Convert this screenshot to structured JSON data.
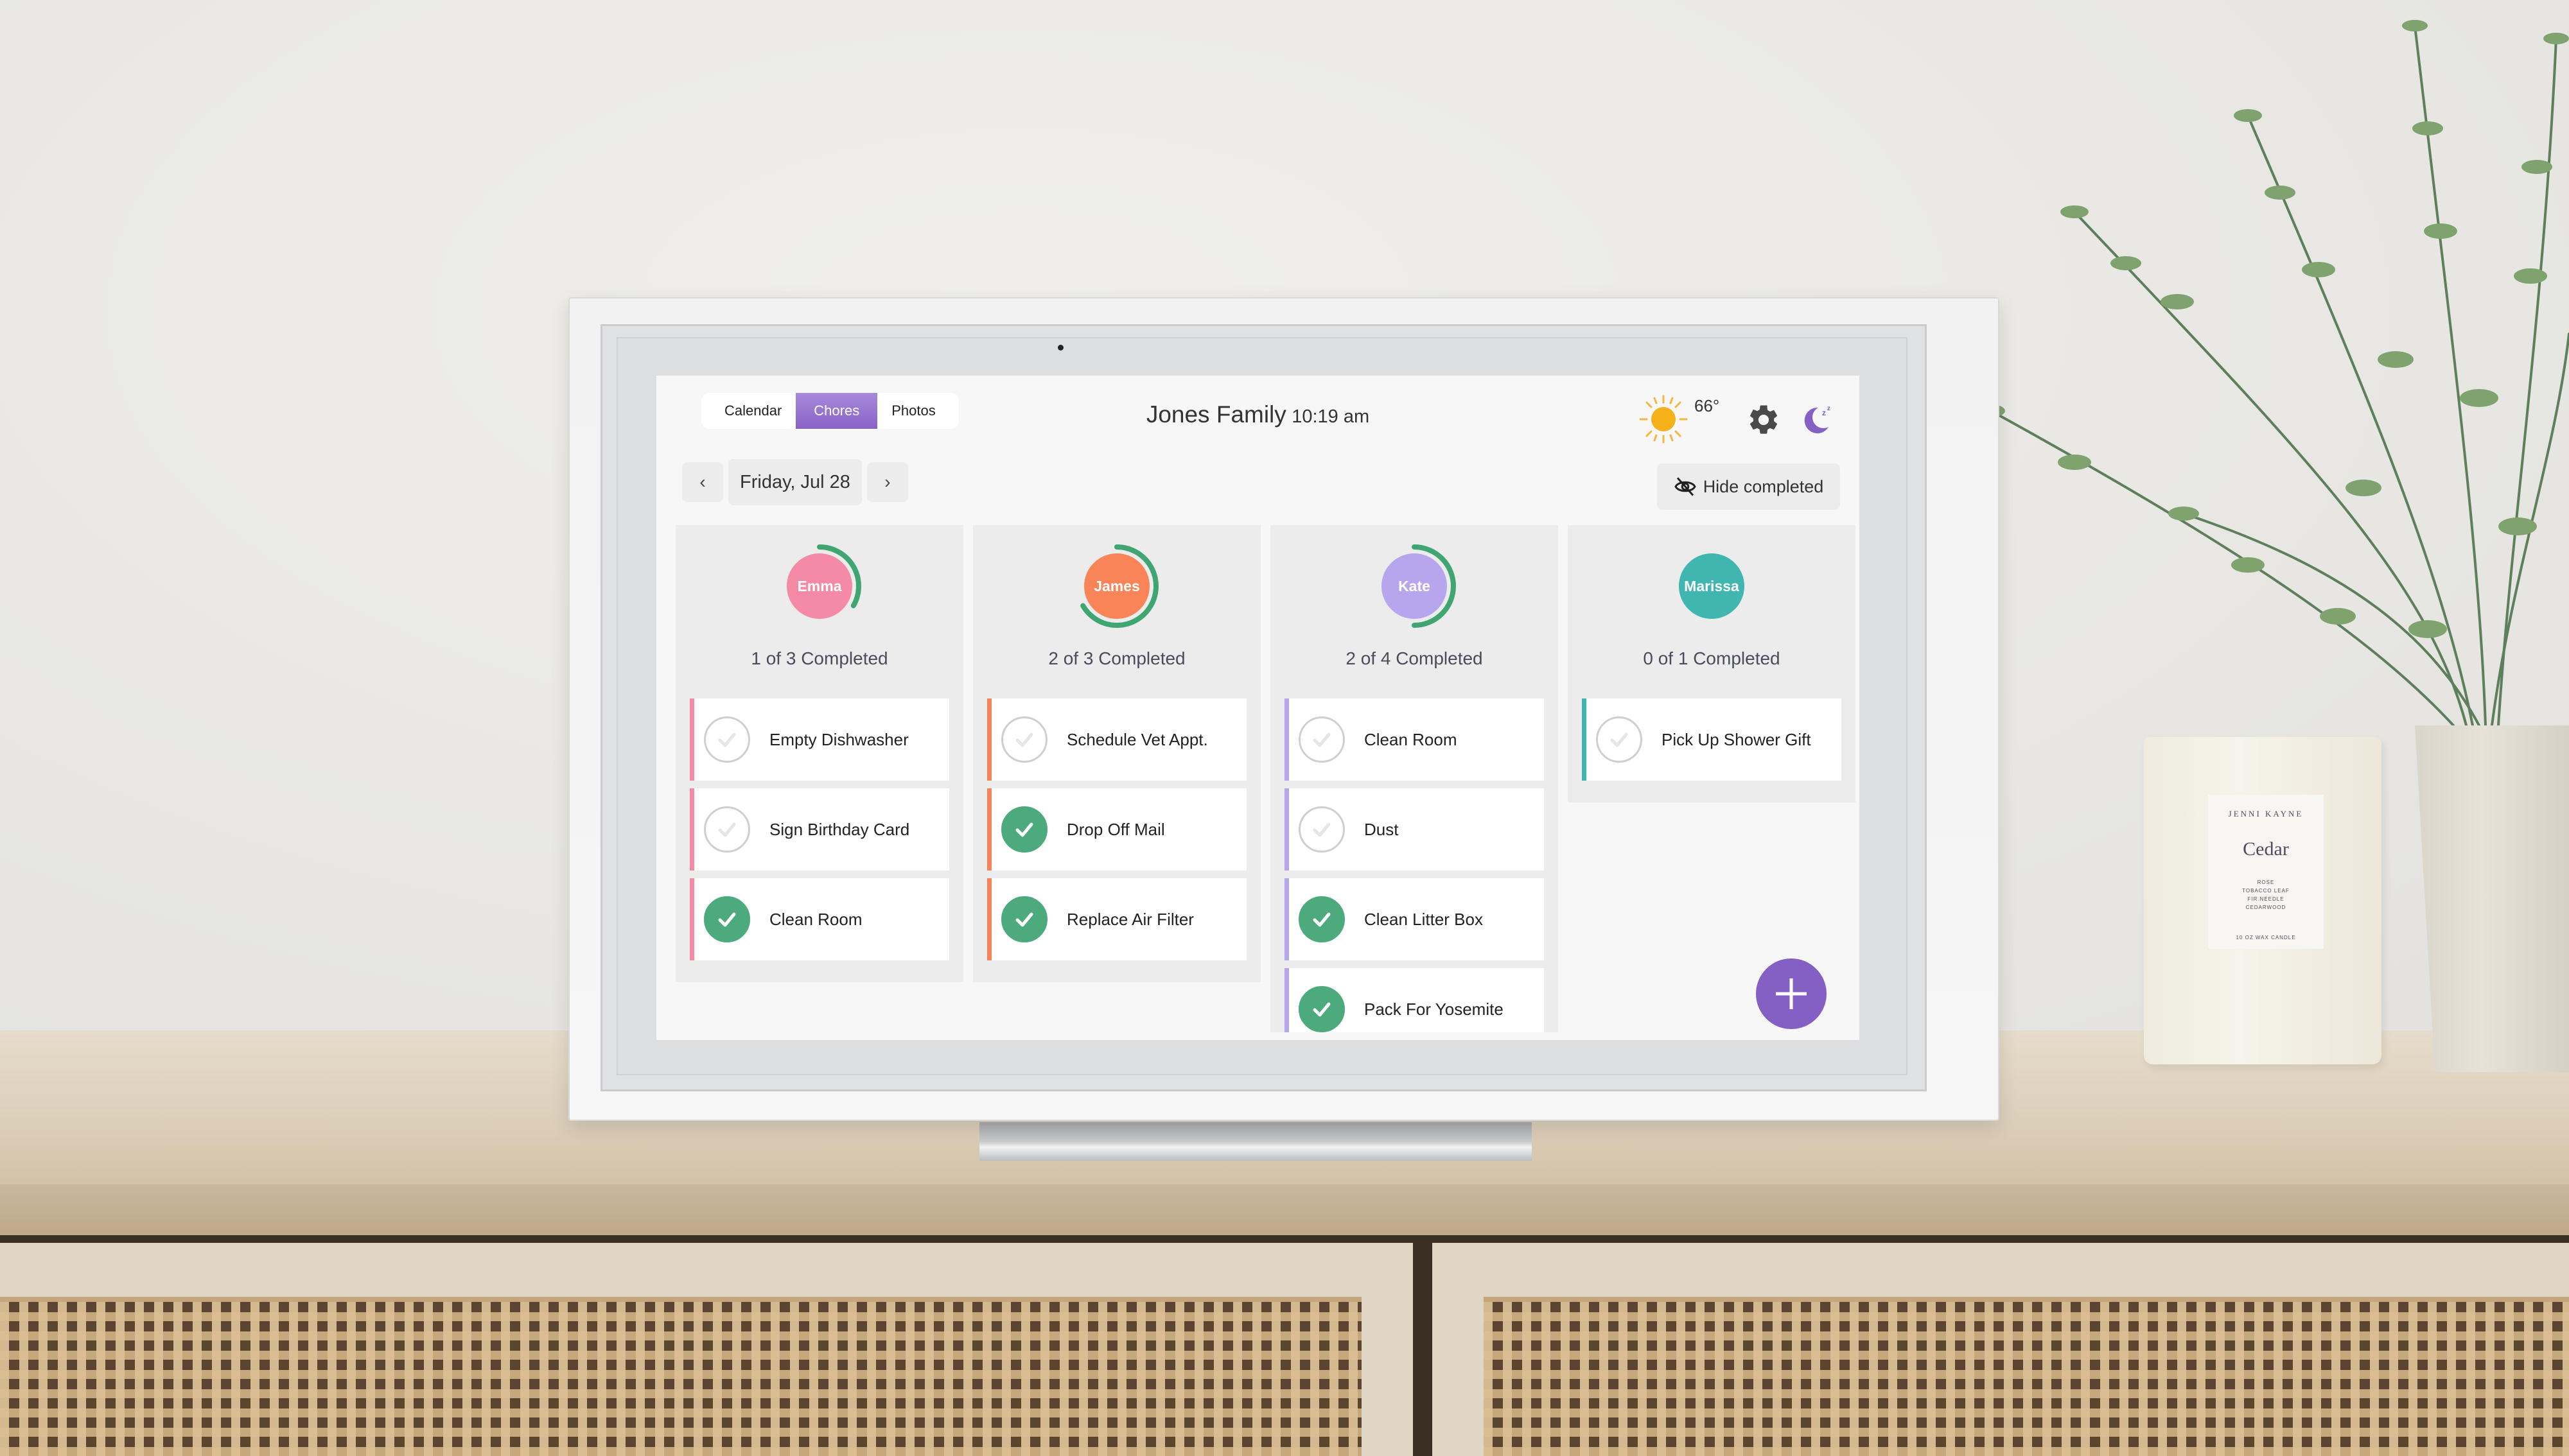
{
  "tabs": [
    {
      "label": "Calendar",
      "active": false
    },
    {
      "label": "Chores",
      "active": true
    },
    {
      "label": "Photos",
      "active": false
    }
  ],
  "header": {
    "family_name": "Jones Family",
    "time": "10:19 am",
    "weather_icon": "sun-icon",
    "temperature": "66°",
    "settings_icon": "gear-icon",
    "sleep_icon": "moon-sleep-icon"
  },
  "date_nav": {
    "prev_icon": "‹",
    "date": "Friday, Jul 28",
    "next_icon": "›"
  },
  "hide_completed": {
    "label": "Hide completed",
    "icon": "eye-off-icon"
  },
  "colors": {
    "accent": "#8460c4",
    "done_green": "#4caa7d",
    "progress_green": "#3fa672"
  },
  "members": [
    {
      "name": "Emma",
      "color": "#f48aa5",
      "progress_label": "1 of 3 Completed",
      "completed": 1,
      "total": 3,
      "chores": [
        {
          "label": "Empty Dishwasher",
          "done": false
        },
        {
          "label": "Sign Birthday Card",
          "done": false
        },
        {
          "label": "Clean Room",
          "done": true
        }
      ]
    },
    {
      "name": "James",
      "color": "#f88457",
      "progress_label": "2 of 3 Completed",
      "completed": 2,
      "total": 3,
      "chores": [
        {
          "label": "Schedule Vet Appt.",
          "done": false
        },
        {
          "label": "Drop Off Mail",
          "done": true
        },
        {
          "label": "Replace Air Filter",
          "done": true
        }
      ]
    },
    {
      "name": "Kate",
      "color": "#b7a6ee",
      "progress_label": "2 of 4 Completed",
      "completed": 2,
      "total": 4,
      "chores": [
        {
          "label": "Clean Room",
          "done": false
        },
        {
          "label": "Dust",
          "done": false
        },
        {
          "label": "Clean Litter Box",
          "done": true
        },
        {
          "label": "Pack For Yosemite",
          "done": true
        }
      ]
    },
    {
      "name": "Marissa",
      "color": "#3fb7b0",
      "progress_label": "0 of 1 Completed",
      "completed": 0,
      "total": 1,
      "chores": [
        {
          "label": "Pick Up Shower Gift",
          "done": false
        }
      ]
    }
  ],
  "fab": {
    "icon": "plus-icon"
  },
  "scene": {
    "candle": {
      "brand": "JENNI KAYNE",
      "name": "Cedar",
      "notes": [
        "ROSE",
        "TOBACCO LEAF",
        "FIR NEEDLE",
        "CEDARWOOD"
      ],
      "size": "10 OZ WAX CANDLE"
    }
  }
}
